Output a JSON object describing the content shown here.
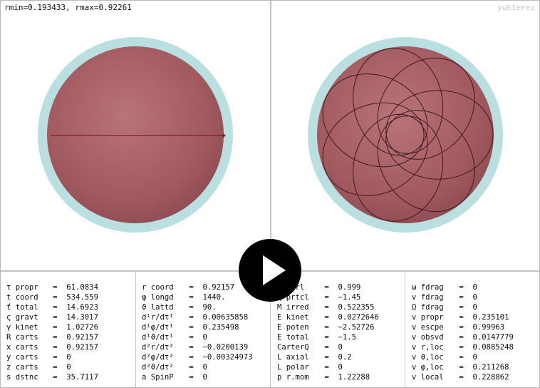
{
  "header": {
    "rrange": "rmin=0.193433, rmax=0.92261",
    "brand": "yukterez"
  },
  "panels": {
    "col1": [
      {
        "sym": "τ",
        "name": "propr",
        "val": "61.0834"
      },
      {
        "sym": "t",
        "name": "coord",
        "val": "534.559"
      },
      {
        "sym": "ť",
        "name": "total",
        "val": "14.6923"
      },
      {
        "sym": "ς",
        "name": "gravt",
        "val": "14.3017"
      },
      {
        "sym": "γ",
        "name": "kinet",
        "val": "1.02726"
      },
      {
        "sym": "R",
        "name": "carts",
        "val": "0.92157"
      },
      {
        "sym": "x",
        "name": "carts",
        "val": "0.92157"
      },
      {
        "sym": "y",
        "name": "carts",
        "val": "0"
      },
      {
        "sym": "z",
        "name": "carts",
        "val": "0"
      },
      {
        "sym": "s",
        "name": "dstnc",
        "val": "35.7117"
      }
    ],
    "col2": [
      {
        "label": "r coord",
        "val": "0.92157"
      },
      {
        "label": "φ longd",
        "val": "1440."
      },
      {
        "label": "ϑ lattd",
        "val": "90."
      },
      {
        "label": "d¹r/dτ¹",
        "val": "0.00635858"
      },
      {
        "label": "d¹φ/dτ¹",
        "val": "0.235498"
      },
      {
        "label": "d¹ϑ/dτ¹",
        "val": "0"
      },
      {
        "label": "d²r/dτ²",
        "val": "−0.0200139"
      },
      {
        "label": "d²φ/dτ²",
        "val": "−0.00324973"
      },
      {
        "label": "d²ϑ/dτ²",
        "val": "0"
      },
      {
        "label": "a SpinP",
        "val": "0"
      }
    ],
    "col3": [
      {
        "label": "Q ctrl",
        "val": "0.999"
      },
      {
        "label": "q prtcl",
        "val": "−1.45"
      },
      {
        "label": "M irred",
        "val": "0.522355"
      },
      {
        "label": "E kinet",
        "val": "0.0272646"
      },
      {
        "label": "E poten",
        "val": "−2.52726"
      },
      {
        "label": "E total",
        "val": "−1.5"
      },
      {
        "label": "CarterQ",
        "val": "0"
      },
      {
        "label": "L axial",
        "val": "0.2"
      },
      {
        "label": "L polar",
        "val": "0"
      },
      {
        "label": "p r.mom",
        "val": "1.22288"
      }
    ],
    "col4": [
      {
        "label": "ω fdrag",
        "val": "0"
      },
      {
        "label": "v fdrag",
        "val": "0"
      },
      {
        "label": "Ω fdrag",
        "val": "0"
      },
      {
        "label": "v propr",
        "val": "0.235101"
      },
      {
        "label": "v escpe",
        "val": "0.99963"
      },
      {
        "label": "v obsvd",
        "val": "0.0147779"
      },
      {
        "label": "v r,loc",
        "val": "0.0885248"
      },
      {
        "label": "v ϑ,loc",
        "val": "0"
      },
      {
        "label": "v φ,loc",
        "val": "0.211268"
      },
      {
        "label": "v local",
        "val": "0.228862"
      }
    ]
  },
  "colors": {
    "sphere_inner": "#a85f64",
    "sphere_outer": "#b9dfe0",
    "orbit_line": "#7a1f2a",
    "background": "#ffffff"
  },
  "icons": {
    "play": "play-icon"
  }
}
